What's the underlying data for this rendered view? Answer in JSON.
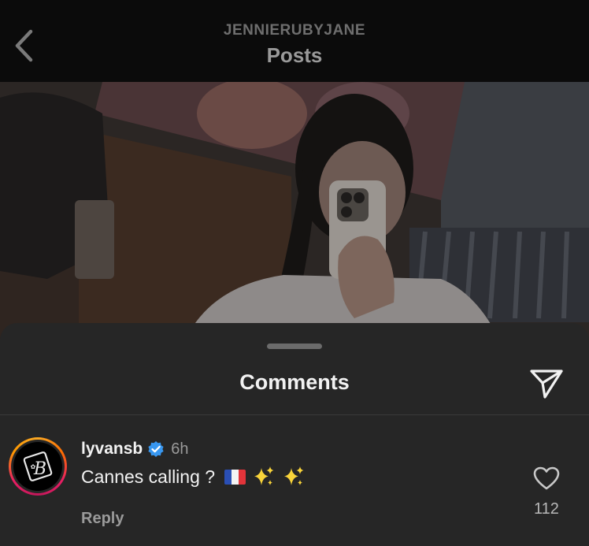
{
  "header": {
    "back_icon": "chevron-left-icon",
    "account": "JENNIERUBYJANE",
    "title": "Posts"
  },
  "post": {
    "image": "mirror-selfie-photo"
  },
  "comments_sheet": {
    "title": "Comments",
    "share_icon": "paper-plane-icon",
    "comments": [
      {
        "username": "lyvansb",
        "verified": true,
        "time": "6h",
        "text": "Cannes calling ?",
        "emojis": [
          "france-flag-icon",
          "sparkles-icon",
          "sparkles-icon"
        ],
        "reply_label": "Reply",
        "like_icon": "heart-icon",
        "likes": "112"
      }
    ]
  },
  "colors": {
    "sheet_bg": "#262626",
    "verified_blue": "#3897f0",
    "muted_text": "#9a9a9a"
  }
}
